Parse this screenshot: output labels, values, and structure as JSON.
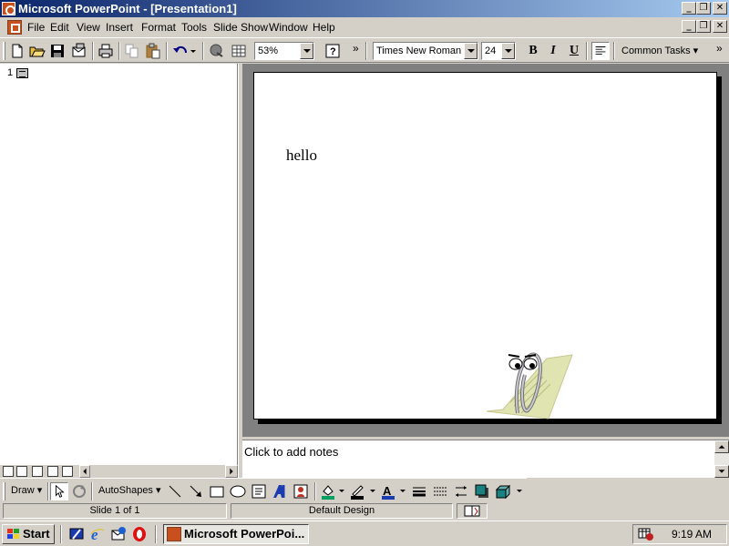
{
  "window": {
    "title": "Microsoft PowerPoint - [Presentation1]",
    "caption_buttons": [
      "_",
      "❐",
      "✕"
    ]
  },
  "menu": {
    "items": [
      "File",
      "Edit",
      "View",
      "Insert",
      "Format",
      "Tools",
      "Slide Show",
      "Window",
      "Help"
    ],
    "doc_buttons": [
      "_",
      "❐",
      "✕"
    ]
  },
  "toolbar": {
    "zoom": "53%",
    "font": "Times New Roman",
    "font_size": "24",
    "bold": "B",
    "italic": "I",
    "underline": "U",
    "common_tasks": "Common Tasks ▾",
    "overflow": "»"
  },
  "outline": {
    "slide_number": "1"
  },
  "slide": {
    "text": "hello"
  },
  "notes": {
    "placeholder": "Click to add notes"
  },
  "drawing_toolbar": {
    "draw_label": "Draw ▾",
    "autoshapes_label": "AutoShapes ▾"
  },
  "status": {
    "slide": "Slide 1 of 1",
    "design": "Default Design"
  },
  "taskbar": {
    "start": "Start",
    "task": "Microsoft PowerPoi...",
    "clock": "9:19 AM"
  },
  "colors": {
    "title_gradient_start": "#0a246a",
    "title_gradient_end": "#a6caf0",
    "chrome": "#d4d0c8",
    "workspace": "#808080",
    "powerpoint_orange": "#c8501e"
  }
}
